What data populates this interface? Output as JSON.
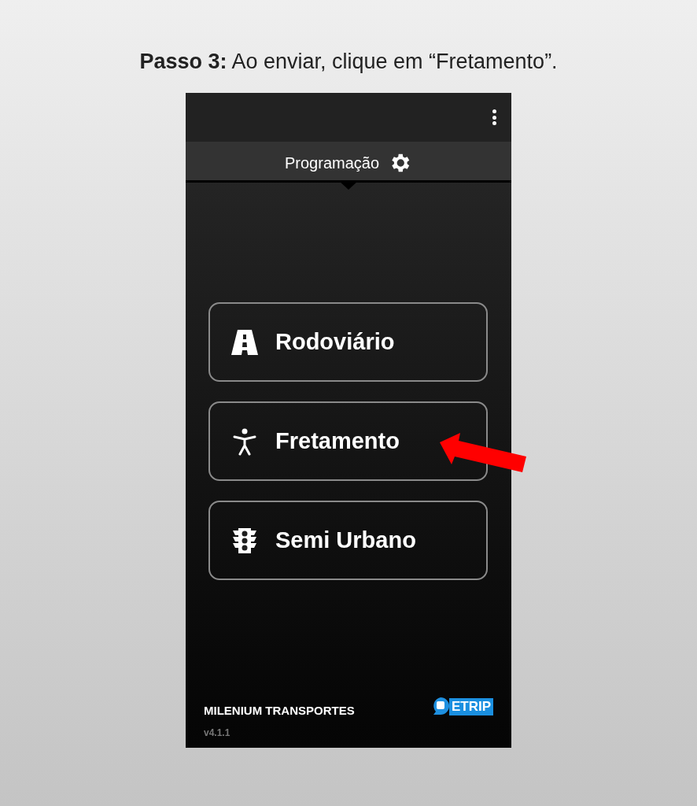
{
  "caption": "**Passo 3:** Ao enviar, clique em “Fretamento”.",
  "tab": {
    "label": "Programação",
    "selected": true
  },
  "buttons": [
    {
      "label": "Rodoviário",
      "kind": "road",
      "highlighted": false
    },
    {
      "label": "Fretamento",
      "kind": "person",
      "highlighted": true
    },
    {
      "label": "Semi Urbano",
      "kind": "traffic",
      "highlighted": false
    }
  ],
  "footer": {
    "company": "MILENIUM TRANSPORTES",
    "version": "v4.1.1",
    "logo_text": "ETRIP"
  }
}
